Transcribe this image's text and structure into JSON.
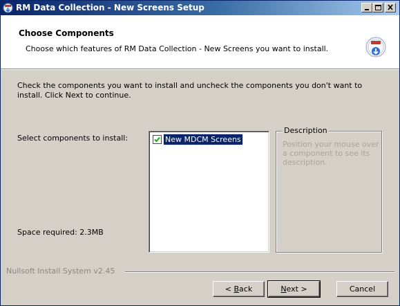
{
  "window": {
    "title": "RM Data Collection - New Screens Setup"
  },
  "header": {
    "title": "Choose Components",
    "subtitle": "Choose which features of RM Data Collection - New Screens you want to install."
  },
  "body": {
    "intro": "Check the components you want to install and uncheck the components you don't want to install. Click Next to continue.",
    "select_label": "Select components to install:",
    "space_required": "Space required: 2.3MB",
    "components": [
      {
        "label": "New MDCM Screens",
        "checked": true,
        "selected": true
      }
    ],
    "description": {
      "legend": "Description",
      "text": "Position your mouse over a component to see its description."
    }
  },
  "footer": {
    "branding": "Nullsoft Install System v2.45",
    "buttons": {
      "back": {
        "pre": "< ",
        "accel": "B",
        "post": "ack"
      },
      "next": {
        "pre": "",
        "accel": "N",
        "post": "ext >"
      },
      "cancel": "Cancel"
    }
  },
  "colors": {
    "title_active": "#0a246a",
    "selection": "#0a246a",
    "face": "#d4d0c8",
    "disabled_text": "#a7a49b"
  }
}
